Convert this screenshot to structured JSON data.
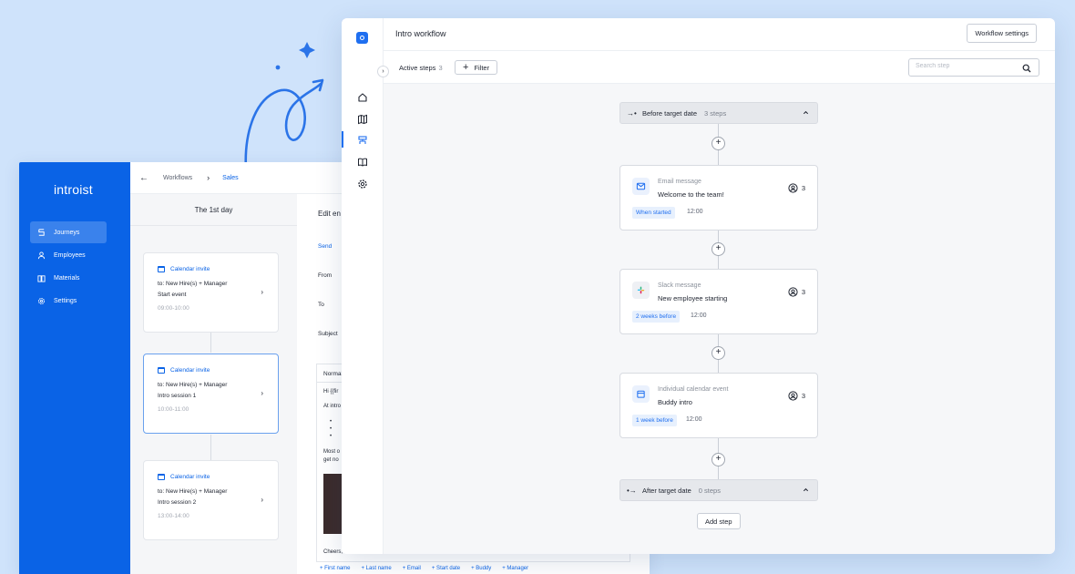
{
  "back": {
    "brand": "introist",
    "nav": [
      {
        "label": "Journeys",
        "icon": "journeys-icon",
        "active": true
      },
      {
        "label": "Employees",
        "icon": "person-icon",
        "active": false
      },
      {
        "label": "Materials",
        "icon": "book-icon",
        "active": false
      },
      {
        "label": "Settings",
        "icon": "gear-icon",
        "active": false
      }
    ],
    "breadcrumb": {
      "parent": "Workflows",
      "current": "Sales"
    },
    "day_title": "The 1st day",
    "cards": [
      {
        "type": "Calendar invite",
        "to": "to: New Hire(s) + Manager",
        "name": "Start event",
        "time": "09:00-10:00"
      },
      {
        "type": "Calendar invite",
        "to": "to: New Hire(s) + Manager",
        "name": "Intro session 1",
        "time": "10:00-11:00"
      },
      {
        "type": "Calendar invite",
        "to": "to: New Hire(s) + Manager",
        "name": "Intro session 2",
        "time": "13:00-14:00"
      }
    ],
    "editor": {
      "title": "Edit en",
      "send": "Send",
      "from": "From",
      "to": "To",
      "subject": "Subject",
      "toolbar": "Normal",
      "line1": "Hi {{fir",
      "line2": "At intro",
      "bullet": "•",
      "line3": "Most o",
      "line4": "get no",
      "closing": "Cheers,"
    },
    "variables": [
      "+ First name",
      "+ Last name",
      "+ Email",
      "+ Start date",
      "+ Buddy",
      "+ Manager"
    ]
  },
  "front": {
    "title": "Intro workflow",
    "settings_button": "Workflow settings",
    "active_steps_label": "Active steps",
    "active_steps_count": "3",
    "filter_label": "Filter",
    "search_placeholder": "Search step",
    "groups": [
      {
        "label": "Before target date",
        "count": "3 steps"
      },
      {
        "label": "After target date",
        "count": "0 steps"
      }
    ],
    "steps": [
      {
        "type": "Email message",
        "name": "Welcome to the team!",
        "recipients": "3",
        "tag": "When started",
        "time": "12:00",
        "icon": "email-icon"
      },
      {
        "type": "Slack message",
        "name": "New employee starting",
        "recipients": "3",
        "tag": "2 weeks before",
        "time": "12:00",
        "icon": "slack-icon"
      },
      {
        "type": "Individual calendar event",
        "name": "Buddy intro",
        "recipients": "3",
        "tag": "1 week before",
        "time": "12:00",
        "icon": "calendar-icon"
      }
    ],
    "add_step": "Add step"
  },
  "colors": {
    "brand_blue": "#0a63e6",
    "accent_blue": "#1f6ff0",
    "page_bg": "#cfe3fb"
  }
}
